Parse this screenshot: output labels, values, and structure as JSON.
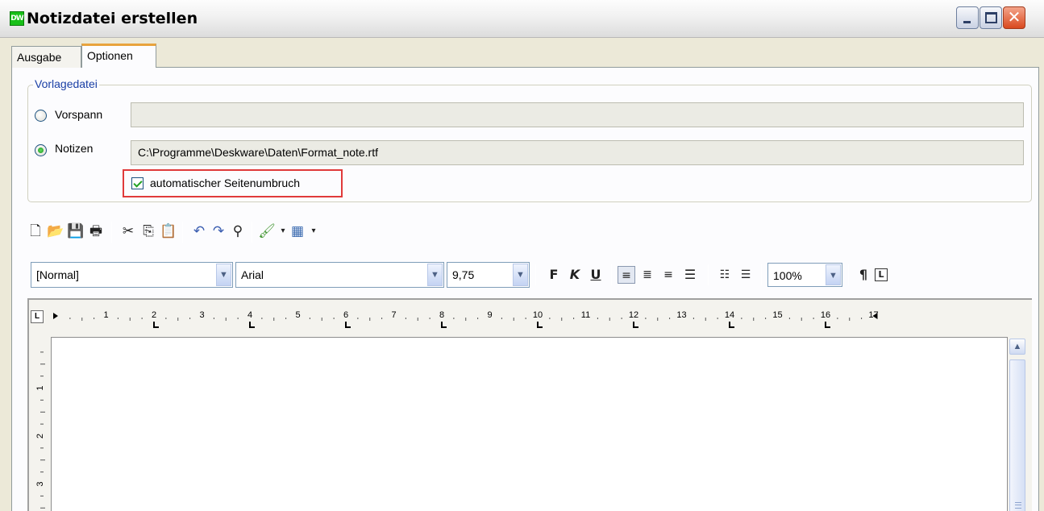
{
  "window": {
    "app_icon_text": "DW",
    "title": "Notizdatei erstellen"
  },
  "tabs": [
    {
      "label": "Ausgabe",
      "active": false
    },
    {
      "label": "Optionen",
      "active": true
    }
  ],
  "vorlagedatei": {
    "legend": "Vorlagedatei",
    "vorspann": {
      "label": "Vorspann",
      "selected": false,
      "value": ""
    },
    "notizen": {
      "label": "Notizen",
      "selected": true,
      "value": "C:\\Programme\\Deskware\\Daten\\Format_note.rtf"
    },
    "auto_umbruch": {
      "label": "automatischer Seitenumbruch",
      "checked": true,
      "highlight_color": "#e03a3a"
    }
  },
  "toolbar1": {
    "icons": [
      "new-document-icon",
      "open-folder-icon",
      "save-disk-icon",
      "print-icon",
      "cut-scissors-icon",
      "copy-icon",
      "paste-icon",
      "undo-icon",
      "redo-icon",
      "find-binoculars-icon",
      "format-painter-icon",
      "table-icon"
    ]
  },
  "toolbar2": {
    "style": "[Normal]",
    "font": "Arial",
    "size": "9,75",
    "bold": "F",
    "italic": "K",
    "underline": "U",
    "zoom": "100%",
    "alignment_selected": "left"
  },
  "ruler": {
    "h_numbers": [
      "1",
      "2",
      "3",
      "4",
      "5",
      "6",
      "7",
      "8",
      "9",
      "10",
      "11",
      "12",
      "13",
      "14",
      "15",
      "16",
      "17"
    ],
    "v_numbers": [
      "1",
      "2",
      "3"
    ]
  },
  "colors": {
    "accent_tab": "#e8a33d",
    "radio_dot": "#1f8f1f",
    "check_mark": "#21a121"
  }
}
